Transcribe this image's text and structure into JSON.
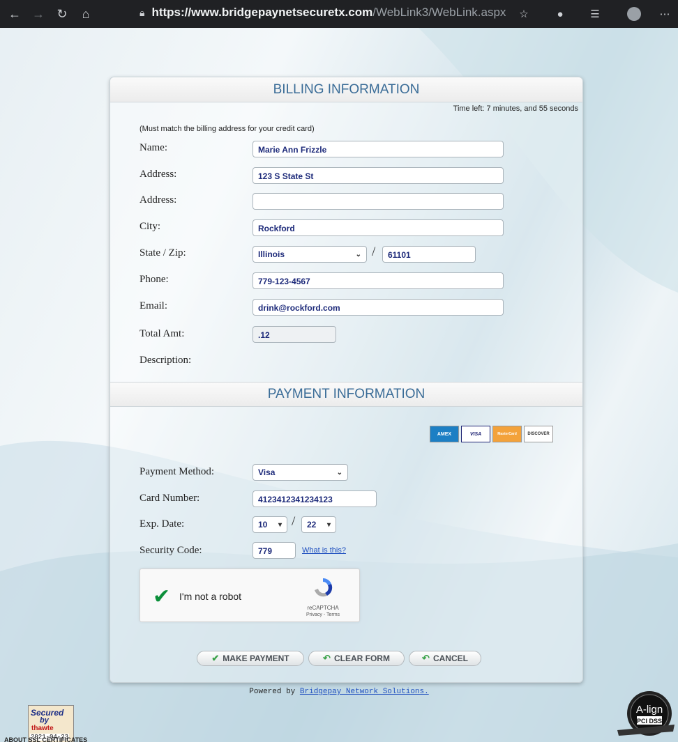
{
  "browser": {
    "url_host": "https://www.bridgepaynetsecuretx.com",
    "url_path": "/WebLink3/WebLink.aspx",
    "icons": [
      "back-icon",
      "forward-icon",
      "reload-icon",
      "home-icon",
      "lock-icon",
      "favorite-icon",
      "extension-icon",
      "collections-icon",
      "profile-icon",
      "more-icon"
    ]
  },
  "billing": {
    "title": "BILLING INFORMATION",
    "time_left": "Time left: 7 minutes, and 55 seconds",
    "note": "(Must match the billing address for your credit card)",
    "name_label": "Name:",
    "name_value": "Marie Ann Frizzle",
    "address1_label": "Address:",
    "address1_value": "123 S State St",
    "address2_label": "Address:",
    "address2_value": "",
    "city_label": "City:",
    "city_value": "Rockford",
    "state_zip_label": "State / Zip:",
    "state_value": "Illinois",
    "zip_value": "61101",
    "phone_label": "Phone:",
    "phone_value": "779-123-4567",
    "email_label": "Email:",
    "email_value": "drink@rockford.com",
    "total_label": "Total Amt:",
    "total_value": ".12",
    "description_label": "Description:"
  },
  "payment": {
    "title": "PAYMENT INFORMATION",
    "cards": [
      "AMEX",
      "VISA",
      "MasterCard",
      "DISCOVER"
    ],
    "method_label": "Payment Method:",
    "method_value": "Visa",
    "card_label": "Card Number:",
    "card_value": "4123412341234123",
    "exp_label": "Exp. Date:",
    "exp_month": "10",
    "exp_year": "22",
    "security_label": "Security Code:",
    "security_value": "779",
    "what_link": "What is this?"
  },
  "captcha": {
    "label": "I'm not a robot",
    "brand": "reCAPTCHA",
    "terms": "Privacy - Terms"
  },
  "buttons": {
    "make_payment": "MAKE PAYMENT",
    "clear_form": "CLEAR FORM",
    "cancel": "CANCEL"
  },
  "footer": {
    "powered_prefix": "Powered by ",
    "powered_link": "Bridgepay Network Solutions.",
    "thawte_secured": "Secured",
    "thawte_by": "by",
    "thawte_brand": "thawte",
    "thawte_date": "2021-04-23",
    "ssl_link": "ABOUT SSL CERTIFICATES",
    "pci_brand": "A-lign",
    "pci_text": "PCI DSS"
  },
  "colors": {
    "heading": "#3a6c97",
    "input_text": "#1d2a7a",
    "link": "#1f4fbf",
    "check": "#0b8f3a"
  }
}
